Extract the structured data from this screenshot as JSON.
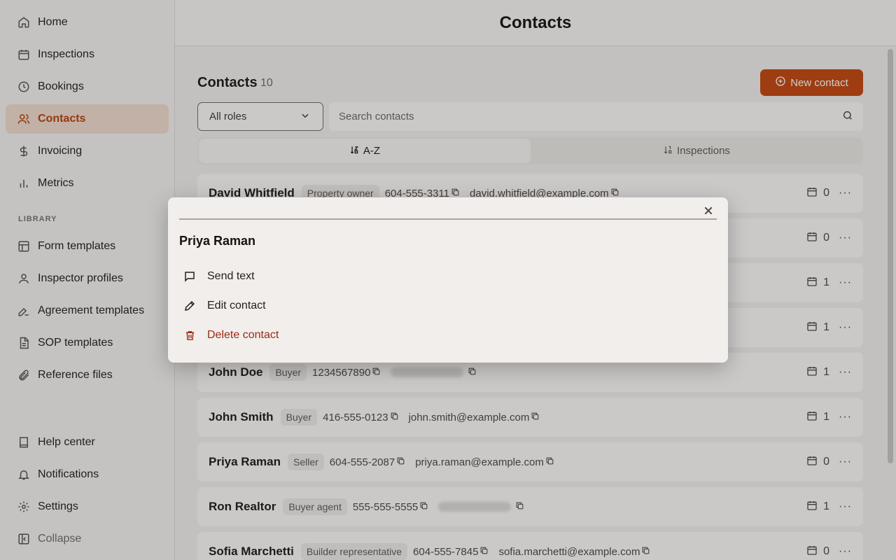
{
  "sidebar": {
    "nav": [
      {
        "label": "Home",
        "icon": "home-icon"
      },
      {
        "label": "Inspections",
        "icon": "calendar-icon"
      },
      {
        "label": "Bookings",
        "icon": "clock-icon"
      },
      {
        "label": "Contacts",
        "icon": "users-icon",
        "active": true
      },
      {
        "label": "Invoicing",
        "icon": "dollar-icon"
      },
      {
        "label": "Metrics",
        "icon": "bar-chart-icon"
      }
    ],
    "library_label": "LIBRARY",
    "library": [
      {
        "label": "Form templates",
        "icon": "layout-icon"
      },
      {
        "label": "Inspector profiles",
        "icon": "user-icon"
      },
      {
        "label": "Agreement templates",
        "icon": "signature-icon"
      },
      {
        "label": "SOP templates",
        "icon": "document-icon"
      },
      {
        "label": "Reference files",
        "icon": "paperclip-icon"
      }
    ],
    "bottom": [
      {
        "label": "Help center",
        "icon": "book-icon"
      },
      {
        "label": "Notifications",
        "icon": "bell-icon"
      },
      {
        "label": "Settings",
        "icon": "gear-icon"
      },
      {
        "label": "Collapse",
        "icon": "sidebar-collapse-icon"
      }
    ]
  },
  "header": {
    "title": "Contacts"
  },
  "list": {
    "title": "Contacts",
    "count": "10",
    "new_button": "New contact",
    "role_filter": "All roles",
    "search_placeholder": "Search contacts",
    "sort": {
      "az": "A-Z",
      "inspections": "Inspections"
    }
  },
  "contacts": [
    {
      "name": "David Whitfield",
      "role": "Property owner",
      "phone": "604-555-3311",
      "email": "david.whitfield@example.com",
      "count": "0"
    },
    {
      "name": "",
      "role": "",
      "phone": "",
      "email": "",
      "count": "0"
    },
    {
      "name": "",
      "role": "",
      "phone": "",
      "email": "",
      "count": "1"
    },
    {
      "name": "",
      "role": "",
      "phone": "",
      "email": "",
      "count": "1"
    },
    {
      "name": "John Doe",
      "role": "Buyer",
      "phone": "1234567890",
      "email": "",
      "count": "1"
    },
    {
      "name": "John Smith",
      "role": "Buyer",
      "phone": "416-555-0123",
      "email": "john.smith@example.com",
      "count": "1"
    },
    {
      "name": "Priya Raman",
      "role": "Seller",
      "phone": "604-555-2087",
      "email": "priya.raman@example.com",
      "count": "0"
    },
    {
      "name": "Ron Realtor",
      "role": "Buyer agent",
      "phone": "555-555-5555",
      "email": "",
      "count": "1"
    },
    {
      "name": "Sofia Marchetti",
      "role": "Builder representative",
      "phone": "604-555-7845",
      "email": "sofia.marchetti@example.com",
      "count": "0"
    }
  ],
  "modal": {
    "title": "Priya Raman",
    "actions": {
      "send_text": "Send text",
      "edit": "Edit contact",
      "delete": "Delete contact"
    }
  },
  "colors": {
    "accent": "#c2470f",
    "danger": "#9b2a16",
    "active_bg": "#f0dccd"
  }
}
